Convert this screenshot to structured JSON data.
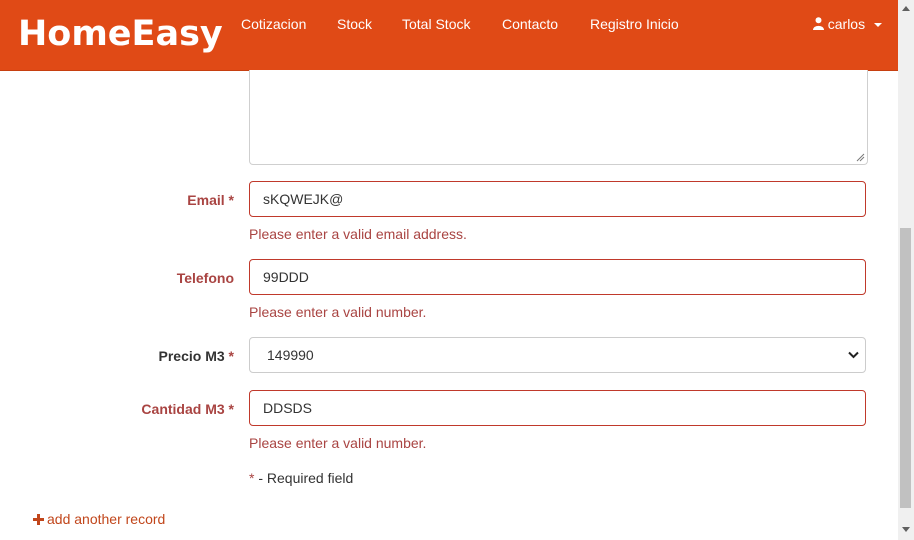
{
  "app": {
    "brand": "HomeEasy"
  },
  "nav": {
    "items": [
      "Cotizacion",
      "Stock",
      "Total Stock",
      "Contacto",
      "Registro Inicio"
    ],
    "user": "carlos"
  },
  "form": {
    "email": {
      "label": "Email",
      "required_mark": "*",
      "value": "sKQWEJK@",
      "error": "Please enter a valid email address."
    },
    "telefono": {
      "label": "Telefono",
      "value": "99DDD",
      "error": "Please enter a valid number."
    },
    "precio": {
      "label": "Precio M3",
      "required_mark": "*",
      "selected": "149990"
    },
    "cantidad": {
      "label": "Cantidad M3",
      "required_mark": "*",
      "value": "DDSDS",
      "error": "Please enter a valid number."
    },
    "required_note_star": "*",
    "required_note_text": " - Required field"
  },
  "footer": {
    "add_record": "add another record"
  },
  "colors": {
    "navbar": "#e04a16",
    "error": "#a94442",
    "link": "#c1461b"
  }
}
